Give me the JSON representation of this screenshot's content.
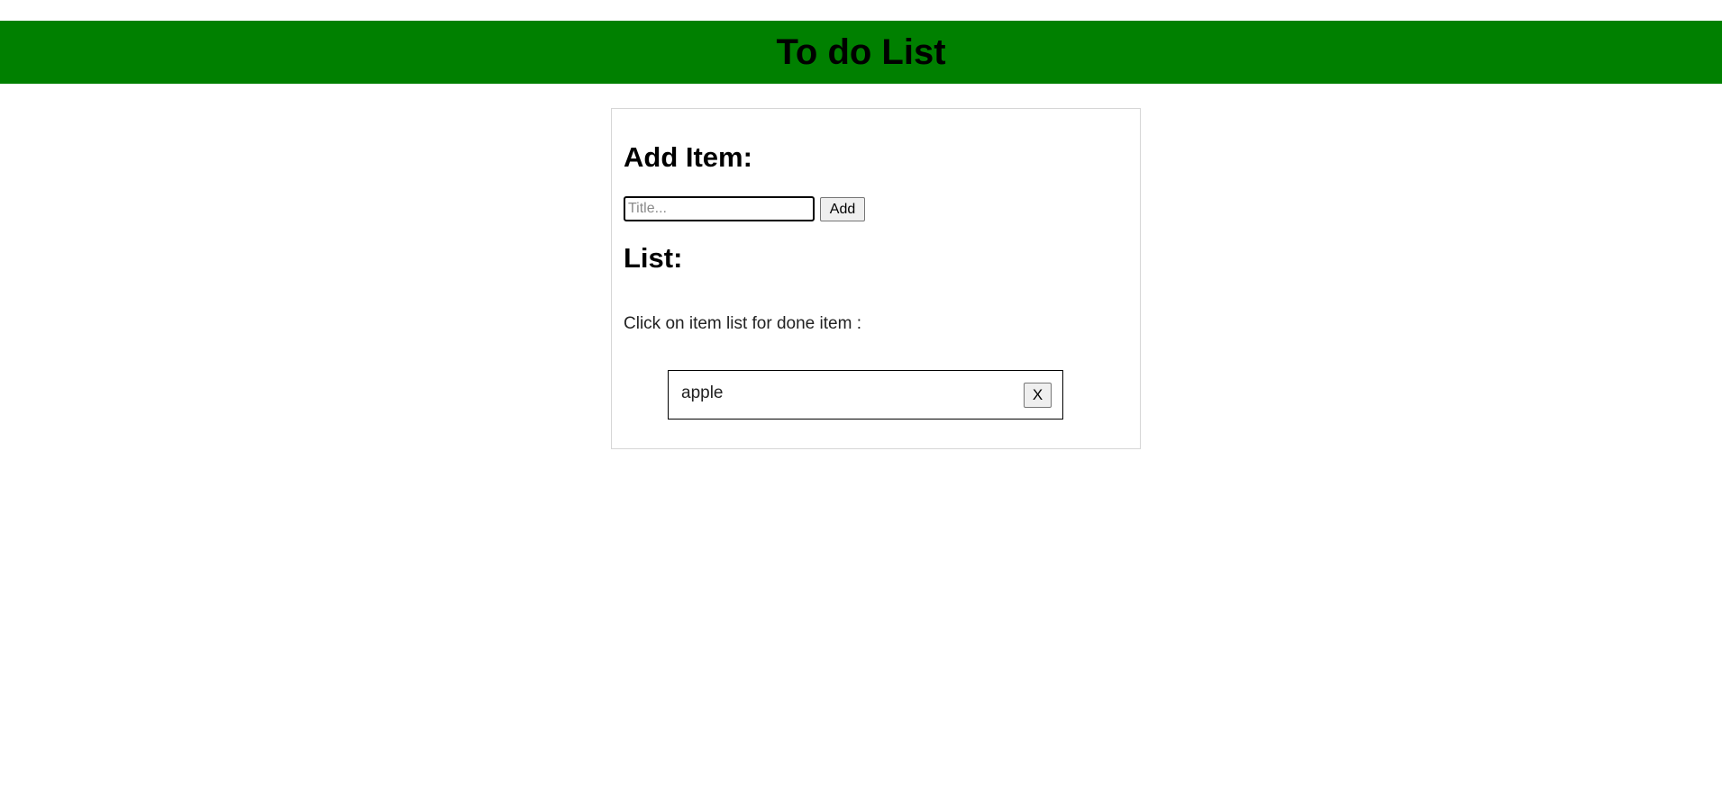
{
  "header": {
    "title": "To do List",
    "background_color": "#008000"
  },
  "add_section": {
    "heading": "Add Item:",
    "input_placeholder": "Title...",
    "input_value": "",
    "add_button_label": "Add"
  },
  "list_section": {
    "heading": "List:",
    "instructions": "Click on item list for done item :",
    "items": [
      {
        "text": "apple",
        "delete_label": "X"
      }
    ]
  }
}
